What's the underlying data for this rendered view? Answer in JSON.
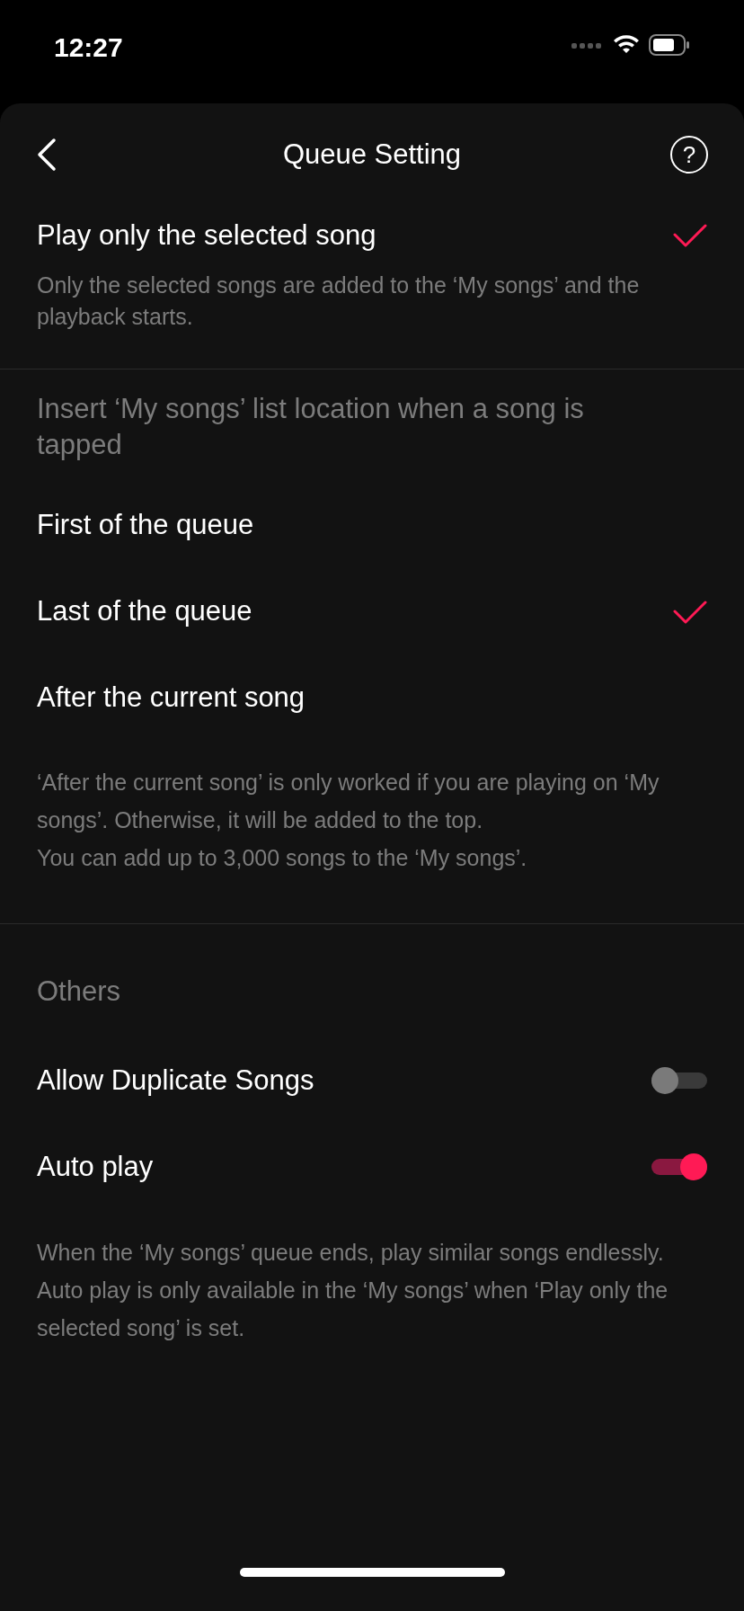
{
  "status_bar": {
    "time": "12:27"
  },
  "header": {
    "title": "Queue Setting",
    "help": "?"
  },
  "play_mode": {
    "label": "Play only the selected song",
    "selected": true,
    "description": "Only the selected songs are added to the ‘My songs’ and the playback starts."
  },
  "insert_location": {
    "heading": "Insert ‘My songs’ list location when a song is tapped",
    "options": [
      {
        "label": "First of the queue",
        "selected": false
      },
      {
        "label": "Last of the queue",
        "selected": true
      },
      {
        "label": "After the current song",
        "selected": false
      }
    ],
    "notes": [
      "‘After the current song’ is only worked if you are playing on ‘My songs’. Otherwise, it will be added to the top.",
      "You can add up to 3,000 songs to the ‘My songs’."
    ]
  },
  "others": {
    "heading": "Others",
    "toggles": [
      {
        "label": "Allow Duplicate Songs",
        "on": false
      },
      {
        "label": "Auto play",
        "on": true
      }
    ],
    "notes": [
      "When the ‘My songs’ queue ends, play similar songs endlessly.",
      "Auto play is only available in the ‘My songs’ when ‘Play only the selected song’ is set."
    ]
  }
}
